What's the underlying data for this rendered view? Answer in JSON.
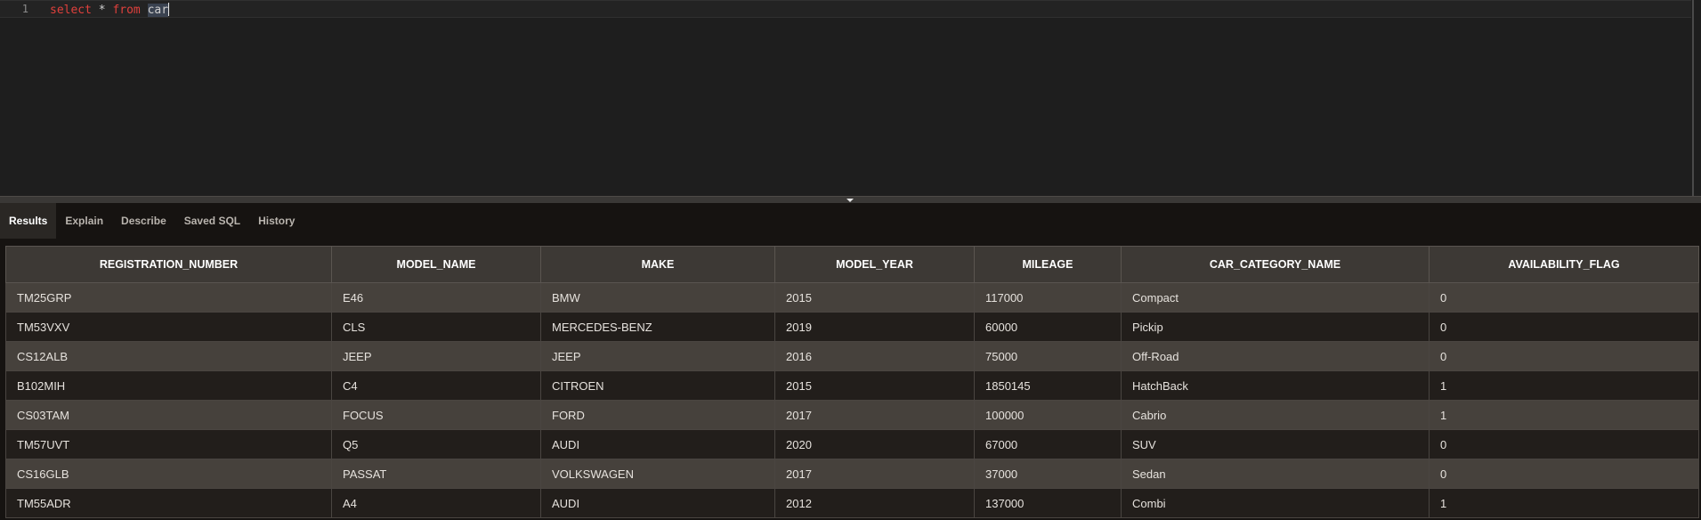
{
  "editor": {
    "line_number": "1",
    "sql_keyword_select": "select",
    "sql_star": " * ",
    "sql_keyword_from": "from",
    "sql_space": " ",
    "sql_table": "car"
  },
  "tabs": [
    {
      "label": "Results",
      "active": true
    },
    {
      "label": "Explain",
      "active": false
    },
    {
      "label": "Describe",
      "active": false
    },
    {
      "label": "Saved SQL",
      "active": false
    },
    {
      "label": "History",
      "active": false
    }
  ],
  "results": {
    "columns": [
      "REGISTRATION_NUMBER",
      "MODEL_NAME",
      "MAKE",
      "MODEL_YEAR",
      "MILEAGE",
      "CAR_CATEGORY_NAME",
      "AVAILABILITY_FLAG"
    ],
    "rows": [
      [
        "TM25GRP",
        "E46",
        "BMW",
        "2015",
        "117000",
        "Compact",
        "0"
      ],
      [
        "TM53VXV",
        "CLS",
        "MERCEDES-BENZ",
        "2019",
        "60000",
        "Pickip",
        "0"
      ],
      [
        "CS12ALB",
        "JEEP",
        "JEEP",
        "2016",
        "75000",
        "Off-Road",
        "0"
      ],
      [
        "B102MIH",
        "C4",
        "CITROEN",
        "2015",
        "1850145",
        "HatchBack",
        "1"
      ],
      [
        "CS03TAM",
        "FOCUS",
        "FORD",
        "2017",
        "100000",
        "Cabrio",
        "1"
      ],
      [
        "TM57UVT",
        "Q5",
        "AUDI",
        "2020",
        "67000",
        "SUV",
        "0"
      ],
      [
        "CS16GLB",
        "PASSAT",
        "VOLKSWAGEN",
        "2017",
        "37000",
        "Sedan",
        "0"
      ],
      [
        "TM55ADR",
        "A4",
        "AUDI",
        "2012",
        "137000",
        "Combi",
        "1"
      ]
    ]
  },
  "colors": {
    "keyword": "#e0403c",
    "header_bg": "#3d3935",
    "row_odd_bg": "#46413c",
    "row_even_bg": "#221e1b"
  }
}
